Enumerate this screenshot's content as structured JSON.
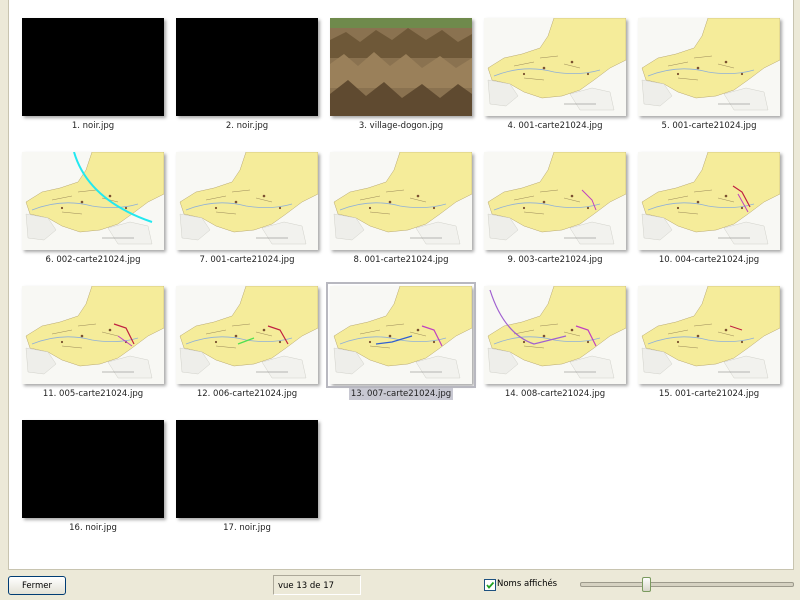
{
  "thumbnails": [
    {
      "caption": "1. noir.jpg",
      "kind": "black"
    },
    {
      "caption": "2. noir.jpg",
      "kind": "black"
    },
    {
      "caption": "3. village-dogon.jpg",
      "kind": "photo"
    },
    {
      "caption": "4. 001-carte21024.jpg",
      "kind": "map"
    },
    {
      "caption": "5. 001-carte21024.jpg",
      "kind": "map"
    },
    {
      "caption": "6. 002-carte21024.jpg",
      "kind": "map"
    },
    {
      "caption": "7. 001-carte21024.jpg",
      "kind": "map"
    },
    {
      "caption": "8. 001-carte21024.jpg",
      "kind": "map"
    },
    {
      "caption": "9. 003-carte21024.jpg",
      "kind": "map"
    },
    {
      "caption": "10. 004-carte21024.jpg",
      "kind": "map"
    },
    {
      "caption": "11. 005-carte21024.jpg",
      "kind": "map"
    },
    {
      "caption": "12. 006-carte21024.jpg",
      "kind": "map"
    },
    {
      "caption": "13. 007-carte21024.jpg",
      "kind": "map",
      "selected": true
    },
    {
      "caption": "14. 008-carte21024.jpg",
      "kind": "map"
    },
    {
      "caption": "15. 001-carte21024.jpg",
      "kind": "map"
    },
    {
      "caption": "16. noir.jpg",
      "kind": "black"
    },
    {
      "caption": "17. noir.jpg",
      "kind": "black"
    }
  ],
  "toolbar": {
    "close_label": "Fermer",
    "status_text": "vue 13 de 17",
    "names_label": "Noms affichés",
    "names_checked": true,
    "zoom_level": 0.3
  }
}
